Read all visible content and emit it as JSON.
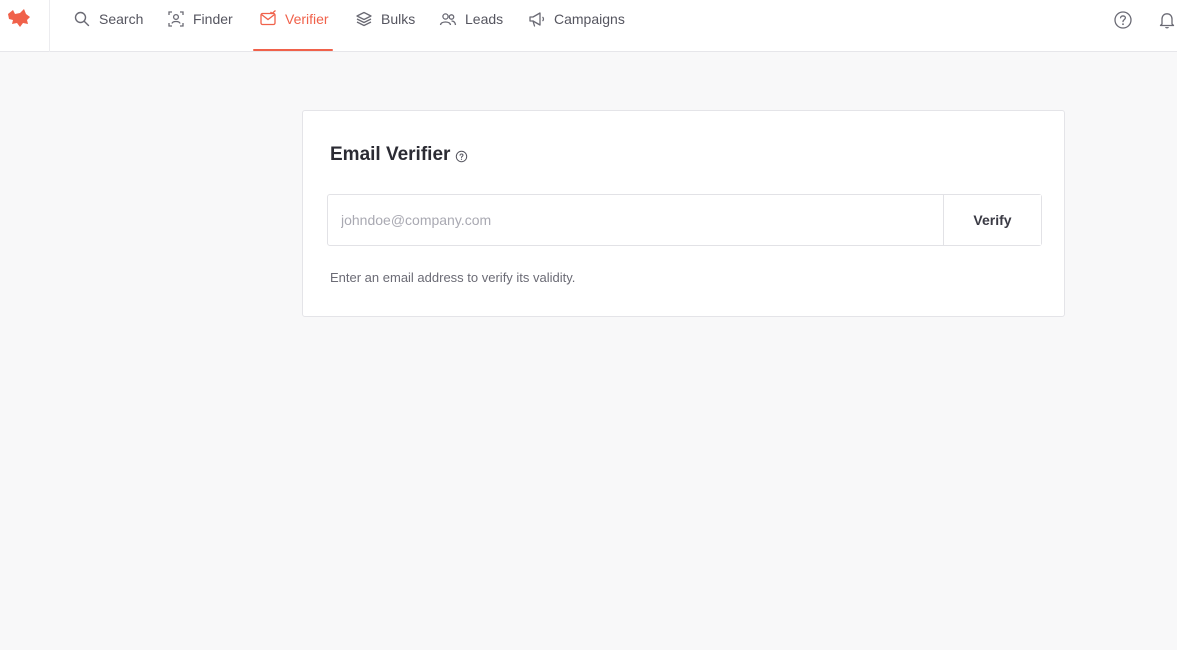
{
  "nav": {
    "items": [
      {
        "id": "search",
        "label": "Search",
        "icon": "search-icon"
      },
      {
        "id": "finder",
        "label": "Finder",
        "icon": "finder-icon"
      },
      {
        "id": "verifier",
        "label": "Verifier",
        "icon": "verifier-icon",
        "active": true
      },
      {
        "id": "bulks",
        "label": "Bulks",
        "icon": "layers-icon"
      },
      {
        "id": "leads",
        "label": "Leads",
        "icon": "users-icon"
      },
      {
        "id": "campaigns",
        "label": "Campaigns",
        "icon": "megaphone-icon"
      }
    ],
    "right_icons": [
      "help-icon",
      "bell-icon"
    ]
  },
  "verifier": {
    "title": "Email Verifier",
    "input_value": "",
    "input_placeholder": "johndoe@company.com",
    "verify_label": "Verify",
    "hint": "Enter an email address to verify its validity."
  },
  "colors": {
    "accent": "#f0614a",
    "background": "#f8f8f9",
    "card": "#ffffff",
    "text": "#2c2c34",
    "muted": "#6b6b75"
  }
}
